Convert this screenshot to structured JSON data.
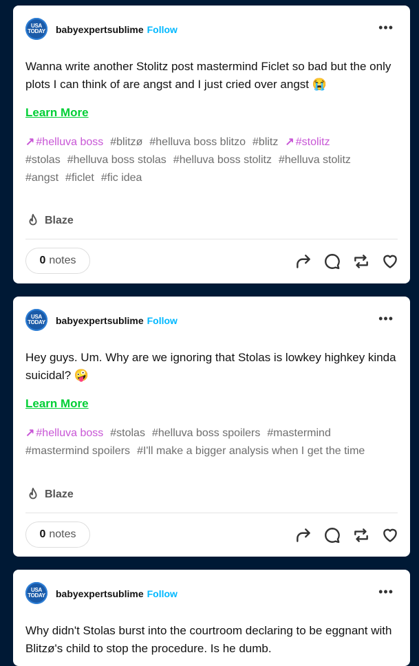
{
  "posts": [
    {
      "avatar_text_1": "USA",
      "avatar_text_2": "TODAY",
      "username": "babyexpertsublime",
      "follow_label": "Follow",
      "more_label": "•••",
      "body": "Wanna write another Stolitz post mastermind Ficlet so bad but the only plots I can think of are angst and I just cried over angst 😭",
      "learn_more": "Learn More",
      "tags_line1": [
        "#helluva boss",
        "#blitzø",
        "#helluva boss blitzo",
        "#blitz",
        "#stolitz"
      ],
      "tags_line2": [
        "#stolas",
        "#helluva boss stolas",
        "#helluva boss stolitz",
        "#helluva stolitz"
      ],
      "tags_line3": [
        "#angst",
        "#ficlet",
        "#fic idea"
      ],
      "blaze_label": "Blaze",
      "notes_count": "0",
      "notes_label": "notes"
    },
    {
      "avatar_text_1": "USA",
      "avatar_text_2": "TODAY",
      "username": "babyexpertsublime",
      "follow_label": "Follow",
      "more_label": "•••",
      "body": "Hey guys. Um. Why are we ignoring that Stolas is lowkey highkey kinda suicidal? 🤪",
      "learn_more": "Learn More",
      "tags_line1": [
        "#helluva boss",
        "#stolas",
        "#helluva boss spoilers",
        "#mastermind"
      ],
      "tags_line2": [
        "#mastermind spoilers",
        "#I'll make a bigger analysis when I get the time"
      ],
      "blaze_label": "Blaze",
      "notes_count": "0",
      "notes_label": "notes"
    },
    {
      "avatar_text_1": "USA",
      "avatar_text_2": "TODAY",
      "username": "babyexpertsublime",
      "follow_label": "Follow",
      "more_label": "•••",
      "body": "Why didn't Stolas burst into the courtroom declaring to be eggnant with Blitzø's child to stop the procedure. Is he dumb."
    }
  ],
  "colors": {
    "background": "#001935",
    "follow": "#00b8ff",
    "learn_more": "#00cf35",
    "trending_tag": "#c856d6",
    "tag": "#6e6e6e"
  },
  "icons": [
    "share-icon",
    "reply-icon",
    "reblog-icon",
    "like-icon",
    "flame-icon",
    "trending-arrow-icon"
  ]
}
